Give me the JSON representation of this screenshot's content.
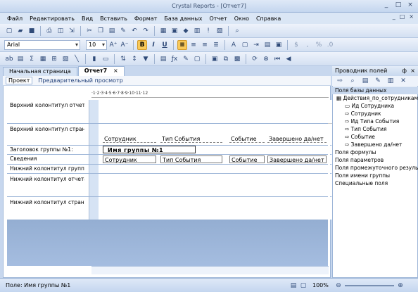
{
  "window": {
    "title": "Crystal Reports - [Отчет7]",
    "buttons": [
      "_",
      "□",
      "×"
    ]
  },
  "menu": {
    "items": [
      "Файл",
      "Редактировать",
      "Вид",
      "Вставить",
      "Формат",
      "База данных",
      "Отчет",
      "Окно",
      "Справка"
    ],
    "right_controls": [
      "_",
      "□",
      "×"
    ]
  },
  "toolbar": {
    "font_name": "Arial",
    "font_size": "10",
    "row1_icons": [
      "new-icon",
      "open-icon",
      "save-icon",
      "print-icon",
      "preview-icon",
      "export-icon",
      "cut-icon",
      "copy-icon",
      "paste-icon",
      "format-painter-icon",
      "undo-icon",
      "redo-icon",
      "field-explorer-icon",
      "report-explorer-icon",
      "repository-icon",
      "dependency-icon",
      "find-icon"
    ],
    "format_icons": [
      "B",
      "I",
      "U"
    ]
  },
  "tabs": [
    {
      "label": "Начальная страница",
      "active": false
    },
    {
      "label": "Отчет7",
      "active": true,
      "close": "×"
    }
  ],
  "subtabs": [
    {
      "label": "Проект",
      "active": true
    },
    {
      "label": "Предварительный просмотр",
      "active": false
    }
  ],
  "ruler": "·1·2·3·4·5·6·7·8·9·10·11·12",
  "sections": [
    {
      "label": "Верхний колонтитул отчет"
    },
    {
      "label": "Верхний колонтитул стран"
    },
    {
      "label": "Заголовок группы №1:"
    },
    {
      "label": "Сведения"
    },
    {
      "label": "Нижний колонтитул групп"
    },
    {
      "label": "Нижний колонтитул отчета"
    },
    {
      "label": "Нижний колонтитул стран"
    }
  ],
  "page_header_fields": [
    "Сотрудник",
    "Тип События",
    "Событие",
    "Завершено да/нет"
  ],
  "group_field": "Имя группы №1",
  "detail_fields": [
    "Сотрудник",
    "Тип События",
    "Событие",
    "Завершено да/нет"
  ],
  "field_panel": {
    "title": "Проводник полей",
    "pin": "ф",
    "close": "×",
    "tree": [
      {
        "label": "Поля базы данных",
        "level": 0,
        "selected": true
      },
      {
        "label": "Действия_по_сотрудникам",
        "level": 1
      },
      {
        "label": "Ид Сотрудника",
        "level": 2
      },
      {
        "label": "Сотрудник",
        "level": 2
      },
      {
        "label": "Ид Типа События",
        "level": 2
      },
      {
        "label": "Тип События",
        "level": 2
      },
      {
        "label": "Событие",
        "level": 2
      },
      {
        "label": "Завершено да/нет",
        "level": 2
      },
      {
        "label": "Поля формулы",
        "level": 0
      },
      {
        "label": "Поля параметров",
        "level": 0
      },
      {
        "label": "Поля промежуточного результ",
        "level": 0
      },
      {
        "label": "Поля имени группы",
        "level": 0
      },
      {
        "label": "Специальные поля",
        "level": 0
      }
    ]
  },
  "status": {
    "text": "Поле: Имя группы №1",
    "zoom": "100%"
  },
  "colors": {
    "accent": "#f8c95a",
    "frame": "#9eb6d8",
    "chrome": "#c7d7ee"
  }
}
